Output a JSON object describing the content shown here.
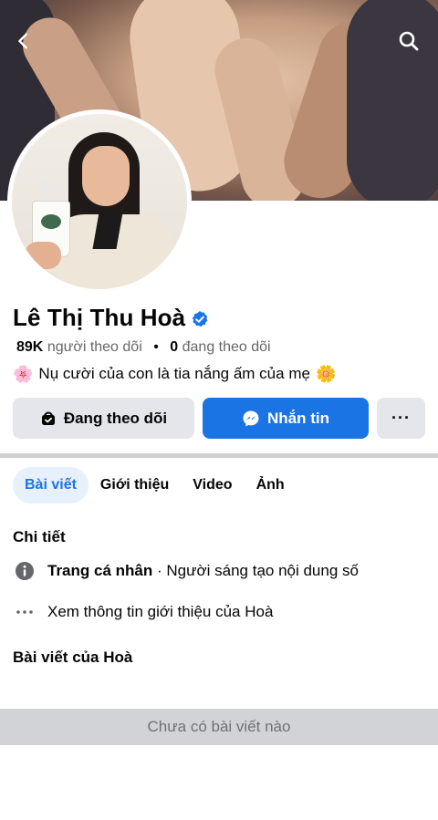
{
  "header": {
    "back_icon": "chevron-left-icon",
    "search_icon": "search-icon"
  },
  "profile": {
    "name": "Lê Thị Thu Hoà",
    "verified_icon": "verified-badge-icon",
    "followers_count": "89K",
    "followers_label": "người theo dõi",
    "separator": "•",
    "following_count": "0",
    "following_label": "đang theo dõi",
    "bio_text": "Nụ cười của con là tia nắng ấm của mẹ",
    "bio_emoji_start": "🌸",
    "bio_emoji_end": "🌼"
  },
  "actions": {
    "following_label": "Đang theo dõi",
    "message_label": "Nhắn tin",
    "more_label": "···"
  },
  "tabs": [
    {
      "label": "Bài viết",
      "active": true
    },
    {
      "label": "Giới thiệu",
      "active": false
    },
    {
      "label": "Video",
      "active": false
    },
    {
      "label": "Ảnh",
      "active": false
    }
  ],
  "details": {
    "title": "Chi tiết",
    "page_type_label": "Trang cá nhân",
    "page_type_value": "· Người sáng tạo nội dung số",
    "see_more": "Xem thông tin giới thiệu của Hoà"
  },
  "posts": {
    "title": "Bài viết của Hoà",
    "empty_text": "Chưa có bài viết nào"
  },
  "colors": {
    "accent": "#1b74e4",
    "button_grey": "#e4e6eb",
    "tab_active_bg": "#e7f0fd",
    "muted_text": "#65676b"
  }
}
